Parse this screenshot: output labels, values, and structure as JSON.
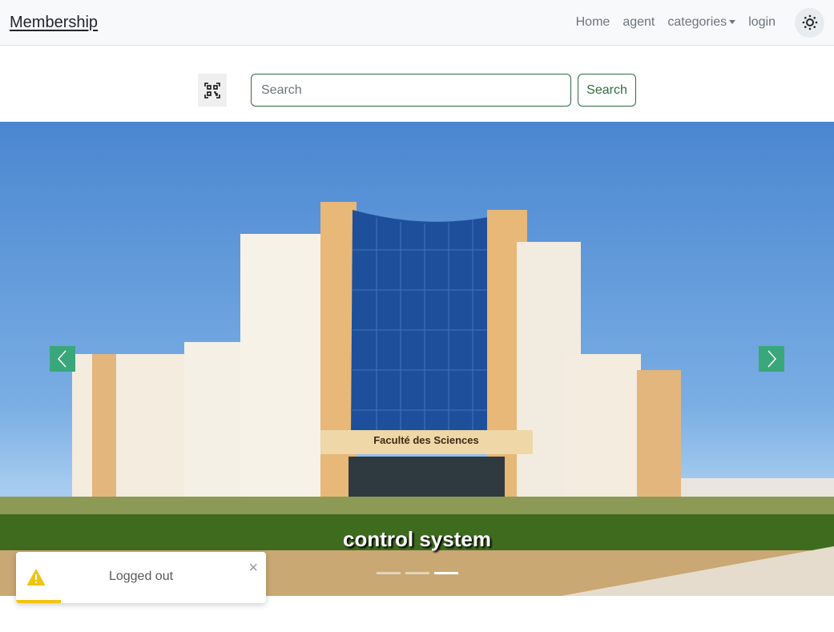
{
  "navbar": {
    "brand": "Membership",
    "links": [
      {
        "label": "Home"
      },
      {
        "label": "agent"
      },
      {
        "label": "categories"
      },
      {
        "label": "login"
      }
    ],
    "theme_icon": "sun-icon"
  },
  "search": {
    "placeholder": "Search",
    "value": "",
    "button_label": "Search",
    "qr_icon": "qr-code-scan-icon"
  },
  "carousel": {
    "caption": "control system",
    "building_sign": "Faculté des Sciences",
    "slide_count": 3,
    "active_slide": 3,
    "accent_color": "#3aa77a"
  },
  "toast": {
    "message": "Logged out",
    "icon": "warning-icon",
    "close_label": "×",
    "progress": 0.18,
    "color": "#f1c40f"
  }
}
